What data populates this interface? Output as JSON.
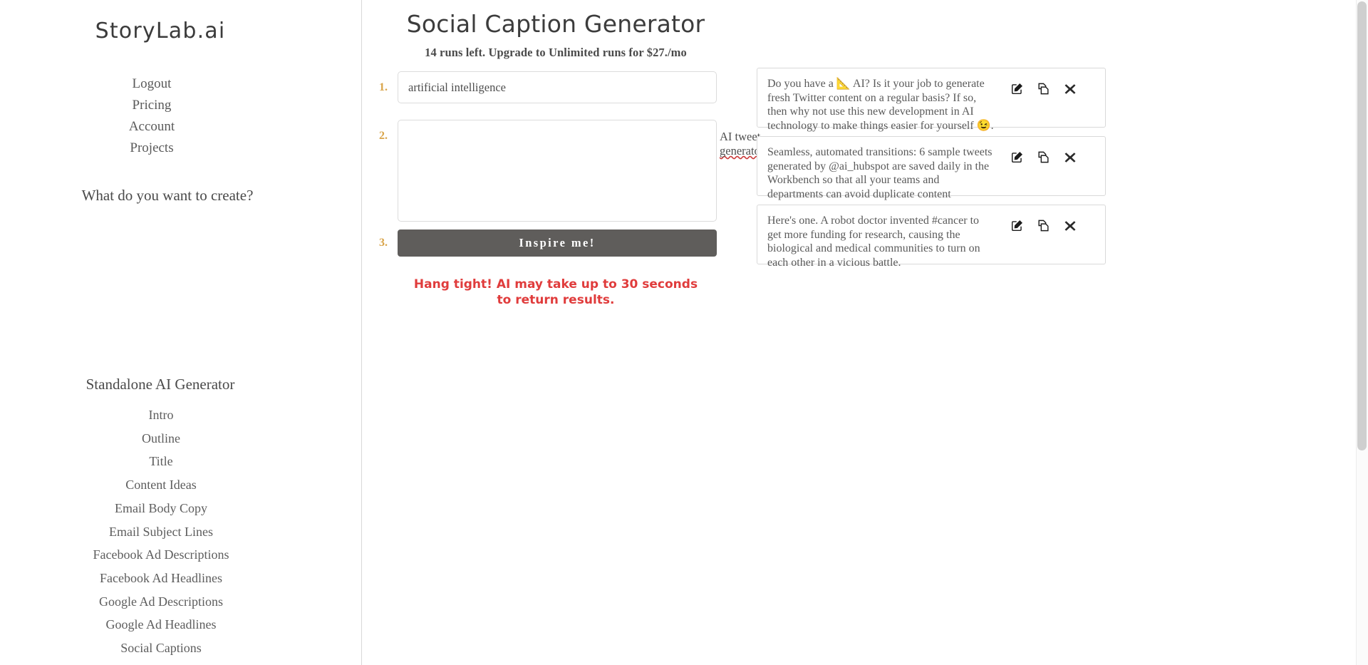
{
  "brand": {
    "name": "StoryLab.ai"
  },
  "sidebar": {
    "nav": [
      {
        "label": "Logout"
      },
      {
        "label": "Pricing"
      },
      {
        "label": "Account"
      },
      {
        "label": "Projects"
      }
    ],
    "prompt_question": "What do you want to create?",
    "standalone_heading": "Standalone AI Generator",
    "generators": [
      {
        "label": "Intro"
      },
      {
        "label": "Outline"
      },
      {
        "label": "Title"
      },
      {
        "label": "Content Ideas"
      },
      {
        "label": "Email Body Copy"
      },
      {
        "label": "Email Subject Lines"
      },
      {
        "label": "Facebook Ad Descriptions"
      },
      {
        "label": "Facebook Ad Headlines"
      },
      {
        "label": "Google Ad Descriptions"
      },
      {
        "label": "Google Ad Headlines"
      },
      {
        "label": "Social Captions"
      }
    ]
  },
  "header": {
    "title": "Social Caption Generator",
    "subtitle": "14 runs left. Upgrade to Unlimited runs for $27./mo"
  },
  "form": {
    "step1_number": "1.",
    "step2_number": "2.",
    "step3_number": "3.",
    "field1_value": "artificial intelligence",
    "field1_placeholder": "artificial intelligence",
    "field2_value_prefix": "AI tweet ",
    "field2_value_misspelled": "generators",
    "field2_placeholder": "AI tweet generators",
    "submit_label": "Inspire me!",
    "notice_line1": "Hang tight! AI may take up to 30 seconds",
    "notice_line2": "to return results.",
    "notice_color": "#e03c3c"
  },
  "results": {
    "cards": [
      {
        "text": "Do you have a 📐 AI? Is it your job to generate fresh Twitter content on a regular basis? If so, then why not use this new development in AI technology to make things easier for yourself 😉.",
        "edit_label": "edit-icon",
        "copy_label": "copy-icon",
        "delete_label": "delete-icon"
      },
      {
        "text": "Seamless, automated transitions: 6 sample tweets generated by @ai_hubspot are saved daily in the Workbench so that all your teams and departments can avoid duplicate content",
        "edit_label": "edit-icon",
        "copy_label": "copy-icon",
        "delete_label": "delete-icon"
      },
      {
        "text": "Here's one. A robot doctor invented #cancer to get more funding for research, causing the biological and medical communities to turn on each other in a vicious battle.",
        "edit_label": "edit-icon",
        "copy_label": "copy-icon",
        "delete_label": "delete-icon"
      }
    ]
  },
  "colors": {
    "step_number": "#d9a44a",
    "button_bg": "#5f5d5b",
    "notice": "#e03c3c",
    "text": "#5a5a5a"
  }
}
